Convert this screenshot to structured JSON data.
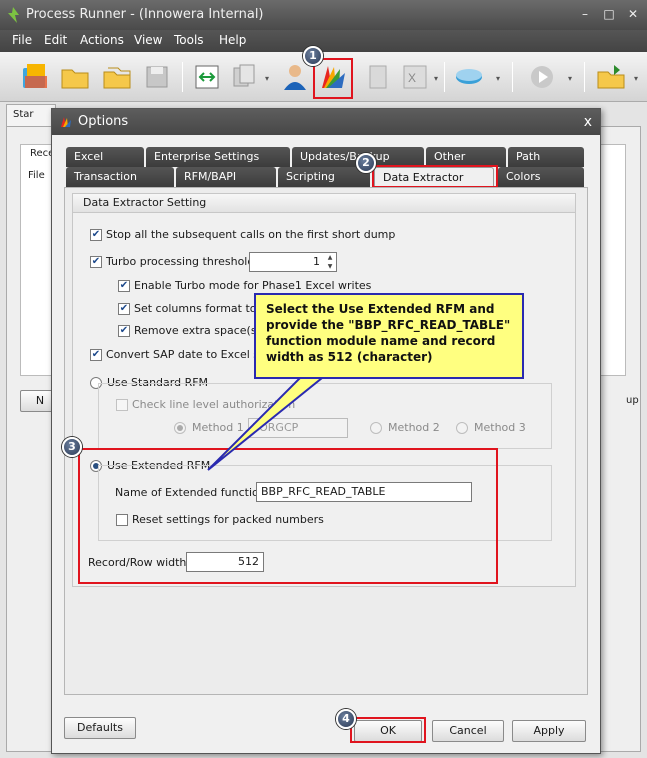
{
  "window": {
    "title": "Process Runner - (Innowera Internal)",
    "minimize": "–",
    "maximize": "□",
    "close": "✕"
  },
  "menu": [
    {
      "label": "File"
    },
    {
      "label": "Edit"
    },
    {
      "label": "Actions"
    },
    {
      "label": "View"
    },
    {
      "label": "Tools"
    },
    {
      "label": "Help"
    }
  ],
  "steps": {
    "one": "1",
    "two": "2",
    "three": "3",
    "four": "4"
  },
  "background": {
    "tab_label": "Star",
    "panel_label": "Rece",
    "col_label": "File",
    "left_button": "N",
    "right_label": "up"
  },
  "dialog": {
    "title": "Options",
    "close": "x",
    "tabs_row1": [
      {
        "label": "Excel"
      },
      {
        "label": "Enterprise Settings"
      },
      {
        "label": "Updates/Backup"
      },
      {
        "label": "Other"
      },
      {
        "label": "Path"
      }
    ],
    "tabs_row2": [
      {
        "label": "Transaction"
      },
      {
        "label": "RFM/BAPI"
      },
      {
        "label": "Scripting"
      },
      {
        "label": "Data Extractor"
      },
      {
        "label": "Colors"
      }
    ],
    "group_title": "Data Extractor Setting",
    "options": {
      "stop_calls": "Stop all the subsequent calls on the first short dump",
      "turbo_threshold": "Turbo processing threshold",
      "turbo_value": "1",
      "enable_turbo": "Enable Turbo mode for Phase1 Excel writes",
      "set_columns": "Set columns format to \"G",
      "remove_spaces": "Remove extra space(s) f",
      "convert_date": "Convert SAP date to Excel sys",
      "use_standard_rfm": "Use Standard RFM",
      "check_line": "Check line level authorization",
      "method1": "Method 1",
      "method1_value": "YORGCP",
      "method2": "Method 2",
      "method3": "Method 3",
      "use_extended_rfm": "Use Extended RFM",
      "ext_function_label": "Name of Extended function:",
      "ext_function_value": "BBP_RFC_READ_TABLE",
      "reset_packed": "Reset settings for packed numbers",
      "record_width_label": "Record/Row width:",
      "record_width_value": "512"
    },
    "buttons": {
      "defaults": "Defaults",
      "ok": "OK",
      "cancel": "Cancel",
      "apply": "Apply"
    }
  },
  "callout": {
    "text": "Select the Use Extended RFM and provide the \"BBP_RFC_READ_TABLE\" function module name and record width as 512 (character)"
  },
  "colors": {
    "highlight": "#e0141e",
    "callout_bg": "#ffff80",
    "callout_border": "#2a2ab0",
    "title_bar": "#4a4a4a"
  }
}
